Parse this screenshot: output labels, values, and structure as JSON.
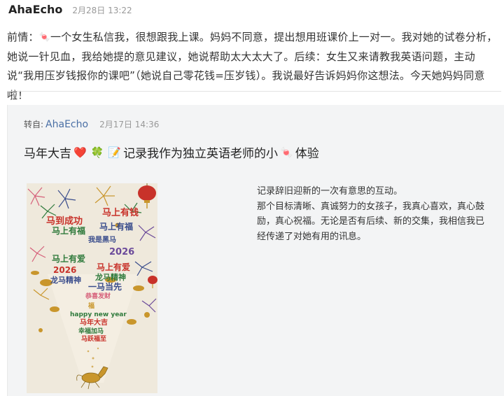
{
  "post": {
    "author": "AhaEcho",
    "time": "2月28日 13:22",
    "text_part1": "前情：",
    "emoji_1": "🍬",
    "text_part2": "一个女生私信我，很想跟我上课。妈妈不同意，提出想用班课价上一对一。我对她的试卷分析，她说一针见血，我给她提的意见建议，她说帮助太大太大了。后续：女生又来请教我英语问题，主动说“我用压岁钱报你的课吧”（她说自己零花钱=压岁钱）。我说最好告诉妈妈你这想法。今天她妈妈同意啦！"
  },
  "repost": {
    "prefix": "转自:",
    "author": "AhaEcho",
    "time": "2月17日 14:36",
    "title_part1": "马年大吉",
    "emoji_heart": "❤️",
    "emoji_clover": "🍀",
    "emoji_memo": "📝",
    "title_part2": "记录我作为独立英语老师的小",
    "emoji_candy": "🍬",
    "title_part3": "体验",
    "body_line1": "记录辞旧迎新的一次有意思的互动。",
    "body_line2": "那个目标清晰、真诚努力的女孩子，我真心喜欢，真心鼓励，真心祝福。无论是否有后续、新的交集，我相信我已经传递了对她有用的讯息。"
  },
  "image": {
    "phrases": [
      "马到成功",
      "马上有钱",
      "马上有福",
      "马上有福",
      "我是黑马",
      "2026",
      "马上有爱",
      "马上有爱",
      "2026",
      "龙马精神",
      "龙马精神",
      "一马当先",
      "恭喜发财",
      "福",
      "happy new year",
      "马年大吉",
      "幸福加马",
      "马跃福至"
    ],
    "colors": {
      "red": "#c8322a",
      "green": "#2f7a3c",
      "blue": "#3a4d8c",
      "gold": "#c9962c",
      "pink": "#d6607a",
      "purple": "#6b4a9a",
      "background": "#efe9dc"
    }
  }
}
